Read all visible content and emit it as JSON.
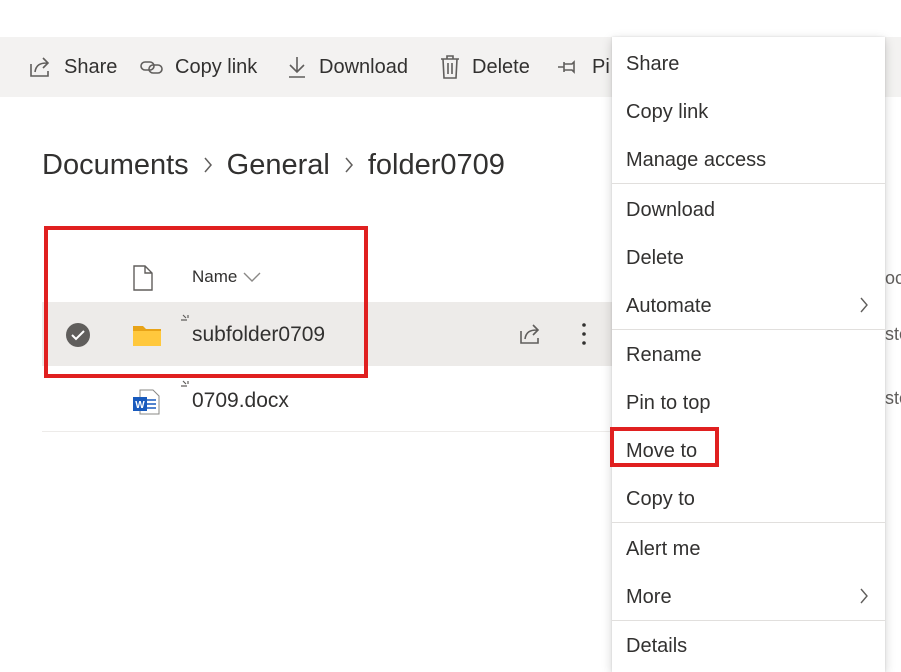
{
  "toolbar": {
    "share": "Share",
    "copy_link": "Copy link",
    "download": "Download",
    "delete": "Delete",
    "pin_partial": "Pi"
  },
  "breadcrumb": [
    "Documents",
    "General",
    "folder0709"
  ],
  "list": {
    "column_name": "Name",
    "rows": [
      {
        "name": "subfolder0709",
        "type": "folder",
        "selected": true
      },
      {
        "name": "0709.docx",
        "type": "word-document",
        "selected": false
      }
    ]
  },
  "right_column_fragments": [
    "oc",
    "ste",
    "ste"
  ],
  "context_menu": {
    "groups": [
      [
        "Share",
        "Copy link",
        "Manage access"
      ],
      [
        "Download",
        "Delete",
        "Automate"
      ],
      [
        "Rename",
        "Pin to top",
        "Move to",
        "Copy to"
      ],
      [
        "Alert me",
        "More"
      ],
      [
        "Details"
      ]
    ],
    "submenu_items": [
      "Automate",
      "More"
    ],
    "highlighted_item": "Move to"
  },
  "highlight_color": "#e02020",
  "colors": {
    "toolbar_bg": "#f3f2f1",
    "selected_row_bg": "#edebe9",
    "folder_yellow": "#ffc83d",
    "word_blue": "#185abd",
    "check_circle": "#605e5c"
  }
}
